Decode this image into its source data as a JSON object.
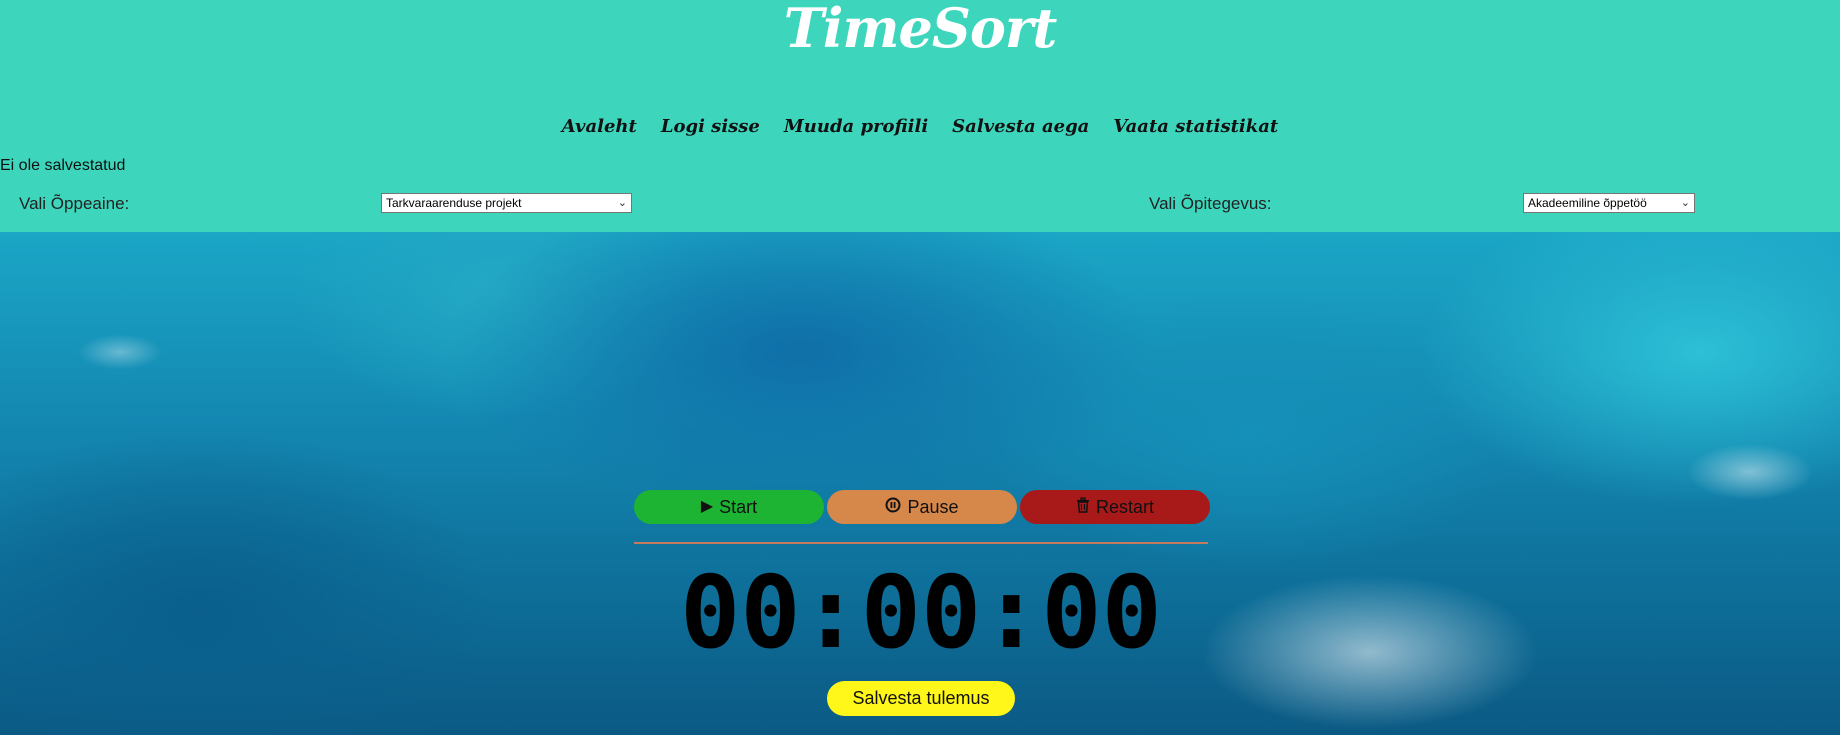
{
  "app": {
    "logo_text": "TimeSort"
  },
  "nav": {
    "items": [
      {
        "label": "Avaleht"
      },
      {
        "label": "Logi sisse"
      },
      {
        "label": "Muuda profiili"
      },
      {
        "label": "Salvesta aega"
      },
      {
        "label": "Vaata statistikat"
      }
    ]
  },
  "status": {
    "save_state": "Ei ole salvestatud"
  },
  "filters": {
    "subject_label": "Vali Õppeaine:",
    "subject_value": "Tarkvaraarenduse projekt",
    "activity_label": "Vali Õpitegevus:",
    "activity_value": "Akadeemiline õppetöö"
  },
  "controls": {
    "start_label": "Start",
    "pause_label": "Pause",
    "restart_label": "Restart",
    "start_icon": "play-icon",
    "pause_icon": "pause-circle-icon",
    "restart_icon": "trash-icon"
  },
  "timer": {
    "display": "00:00:00"
  },
  "actions": {
    "save_result_label": "Salvesta tulemus"
  },
  "colors": {
    "header_bg": "#3dd6bc",
    "start": "#1db333",
    "pause": "#d6874a",
    "restart": "#a81919",
    "save": "#fff719"
  }
}
